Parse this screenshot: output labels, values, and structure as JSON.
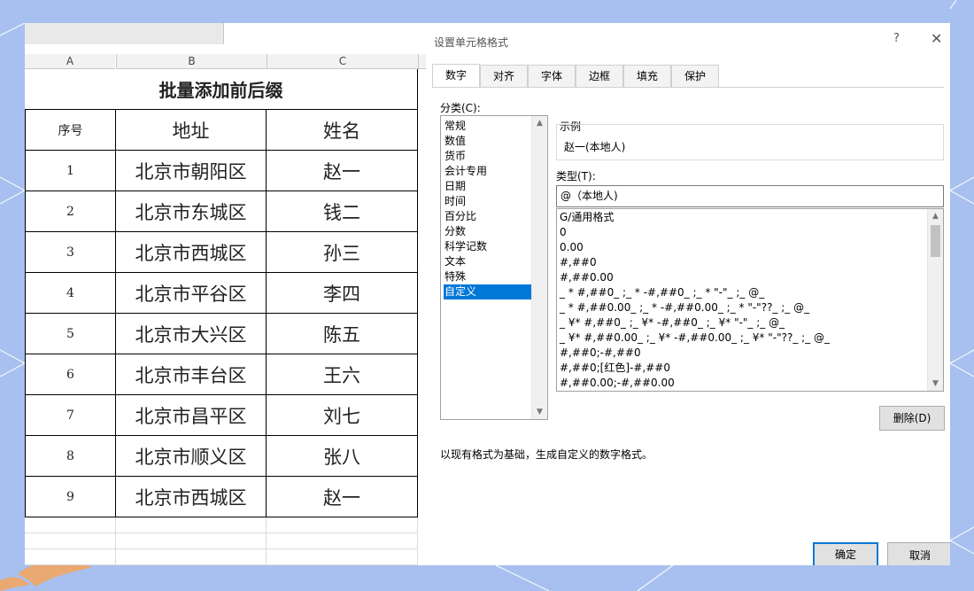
{
  "spreadsheet": {
    "columns": [
      "A",
      "B",
      "C"
    ],
    "title": "批量添加前后缀",
    "headers": [
      "序号",
      "地址",
      "姓名"
    ],
    "rows": [
      [
        "1",
        "北京市朝阳区",
        "赵一"
      ],
      [
        "2",
        "北京市东城区",
        "钱二"
      ],
      [
        "3",
        "北京市西城区",
        "孙三"
      ],
      [
        "4",
        "北京市平谷区",
        "李四"
      ],
      [
        "5",
        "北京市大兴区",
        "陈五"
      ],
      [
        "6",
        "北京市丰台区",
        "王六"
      ],
      [
        "7",
        "北京市昌平区",
        "刘七"
      ],
      [
        "8",
        "北京市顺义区",
        "张八"
      ],
      [
        "9",
        "北京市西城区",
        "赵一"
      ]
    ]
  },
  "dialog": {
    "title": "设置单元格格式",
    "help": "?",
    "close": "✕",
    "tabs": [
      "数字",
      "对齐",
      "字体",
      "边框",
      "填充",
      "保护"
    ],
    "active_tab": "数字",
    "category_label": "分类(C):",
    "categories": [
      "常规",
      "数值",
      "货币",
      "会计专用",
      "日期",
      "时间",
      "百分比",
      "分数",
      "科学记数",
      "文本",
      "特殊",
      "自定义"
    ],
    "selected_category": "自定义",
    "sample_label": "示例",
    "sample_value": "赵一(本地人)",
    "type_label": "类型(T):",
    "type_value": "@（本地人)",
    "formats": [
      "G/通用格式",
      "0",
      "0.00",
      "#,##0",
      "#,##0.00",
      "_ * #,##0_ ;_ * -#,##0_ ;_ * \"-\"_ ;_ @_",
      "_ * #,##0.00_ ;_ * -#,##0.00_ ;_ * \"-\"??_ ;_ @_",
      "_ ¥* #,##0_ ;_ ¥* -#,##0_ ;_ ¥* \"-\"_ ;_ @_",
      "_ ¥* #,##0.00_ ;_ ¥* -#,##0.00_ ;_ ¥* \"-\"??_ ;_ @_",
      "#,##0;-#,##0",
      "#,##0;[红色]-#,##0",
      "#,##0.00;-#,##0.00"
    ],
    "delete_button": "删除(D)",
    "description": "以现有格式为基础，生成自定义的数字格式。",
    "ok_button": "确定",
    "cancel_button": "取消"
  },
  "colors": {
    "background": "#a8c0f0",
    "selection": "#0078d7",
    "accent_orange": "#f5a65b"
  }
}
